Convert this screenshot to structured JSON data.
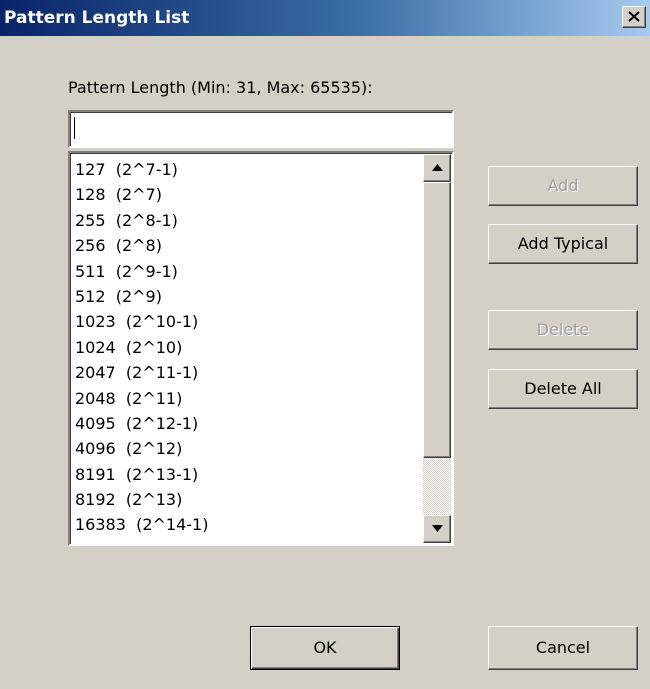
{
  "window": {
    "title": "Pattern Length List"
  },
  "input": {
    "label": "Pattern Length (Min: 31, Max: 65535):",
    "value": ""
  },
  "list": {
    "items": [
      "127  (2^7-1)",
      "128  (2^7)",
      "255  (2^8-1)",
      "256  (2^8)",
      "511  (2^9-1)",
      "512  (2^9)",
      "1023  (2^10-1)",
      "1024  (2^10)",
      "2047  (2^11-1)",
      "2048  (2^11)",
      "4095  (2^12-1)",
      "4096  (2^12)",
      "8191  (2^13-1)",
      "8192  (2^13)",
      "16383  (2^14-1)"
    ]
  },
  "buttons": {
    "add": "Add",
    "add_typical": "Add Typical",
    "delete": "Delete",
    "delete_all": "Delete All",
    "ok": "OK",
    "cancel": "Cancel"
  },
  "colors": {
    "face": "#d4d0c8",
    "title_start": "#0a246a",
    "title_end": "#a6caf0",
    "disabled_text": "#a0a0a0"
  }
}
